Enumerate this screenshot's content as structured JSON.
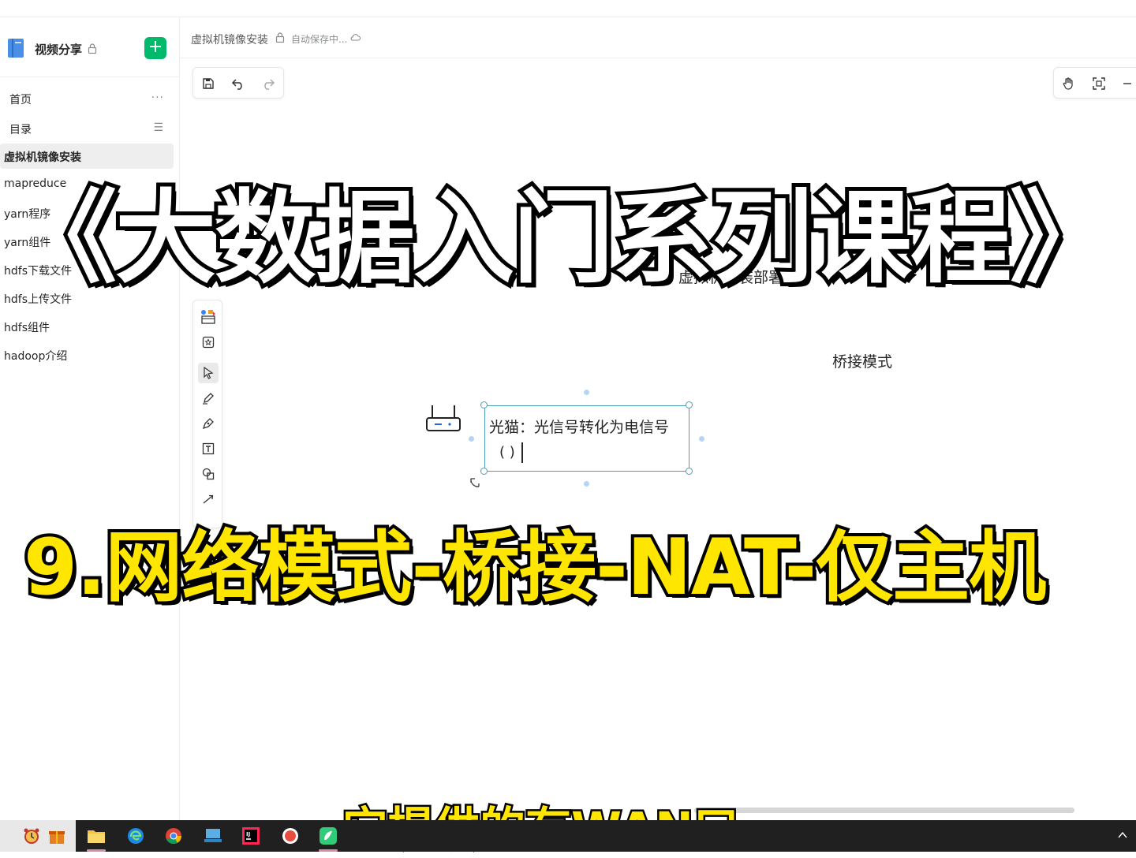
{
  "sidebar": {
    "space_title": "视频分享",
    "add_button": "+",
    "nav": [
      {
        "label": "首页",
        "icon": "more-icon",
        "glyph": "···"
      },
      {
        "label": "目录",
        "icon": "list-icon",
        "glyph": "☰"
      }
    ],
    "docs": [
      {
        "label": "虚拟机镜像安装",
        "active": true
      },
      {
        "label": "mapreduce"
      },
      {
        "label": "yarn程序"
      },
      {
        "label": "yarn组件"
      },
      {
        "label": "hdfs下载文件"
      },
      {
        "label": "hdfs上传文件"
      },
      {
        "label": "hdfs组件"
      },
      {
        "label": "hadoop介绍"
      }
    ]
  },
  "header": {
    "doc_title": "虚拟机镜像安装",
    "save_status": "自动保存中..."
  },
  "canvas": {
    "heading": "虚拟机安装部署",
    "bridge_label": "桥接模式",
    "textbox_line1": "光猫：光信号转化为电信号",
    "textbox_line2": "( )"
  },
  "overlay": {
    "title": "《大数据入门系列课程》",
    "subtitle_big": "9.网络模式-桥接-NAT-仅主机",
    "caption": "它提供的有WAN口"
  },
  "colors": {
    "accent": "#00b96b",
    "selection": "#4a9fb8",
    "caption": "#ffe600"
  }
}
